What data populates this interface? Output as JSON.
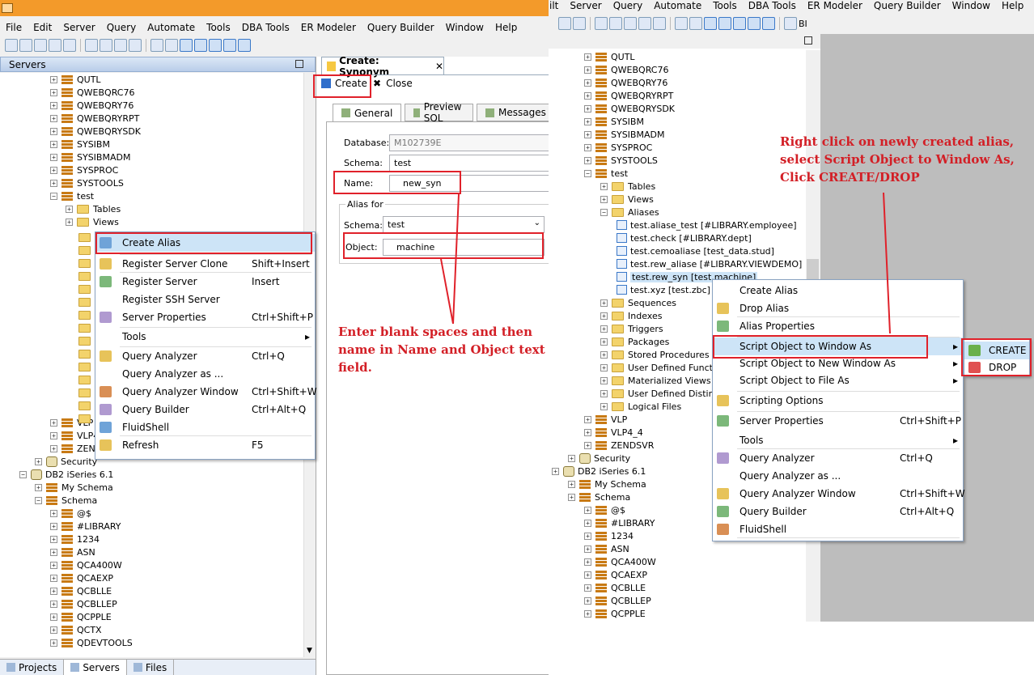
{
  "left": {
    "menu": [
      "File",
      "Edit",
      "Server",
      "Query",
      "Automate",
      "Tools",
      "DBA Tools",
      "ER Modeler",
      "Query Builder",
      "Window",
      "Help"
    ],
    "servers_title": "Servers",
    "tree": [
      {
        "label": "QUTL",
        "kind": "schema",
        "lvl": 3
      },
      {
        "label": "QWEBQRC76",
        "kind": "schema",
        "lvl": 3
      },
      {
        "label": "QWEBQRY76",
        "kind": "schema",
        "lvl": 3
      },
      {
        "label": "QWEBQRYRPT",
        "kind": "schema",
        "lvl": 3
      },
      {
        "label": "QWEBQRYSDK",
        "kind": "schema",
        "lvl": 3
      },
      {
        "label": "SYSIBM",
        "kind": "schema",
        "lvl": 3
      },
      {
        "label": "SYSIBMADM",
        "kind": "schema",
        "lvl": 3
      },
      {
        "label": "SYSPROC",
        "kind": "schema",
        "lvl": 3
      },
      {
        "label": "SYSTOOLS",
        "kind": "schema",
        "lvl": 3
      },
      {
        "label": "test",
        "kind": "schema",
        "lvl": 3,
        "open": true
      },
      {
        "label": "Tables",
        "kind": "folder",
        "lvl": 4
      },
      {
        "label": "Views",
        "kind": "folder",
        "lvl": 4
      }
    ],
    "tree_lower": [
      {
        "label": "VLP",
        "kind": "schema",
        "lvl": 3,
        "row": 28
      },
      {
        "label": "VLP4",
        "kind": "schema",
        "lvl": 3,
        "row": 29
      },
      {
        "label": "ZEND",
        "kind": "schema",
        "lvl": 3,
        "row": 30
      },
      {
        "label": "Security",
        "kind": "db",
        "lvl": 2,
        "row": 31
      },
      {
        "label": "DB2 iSeries 6.1",
        "kind": "db",
        "lvl": 1,
        "row": 32,
        "open": true
      },
      {
        "label": "My Schema",
        "kind": "schema",
        "lvl": 2,
        "row": 33
      },
      {
        "label": "Schema",
        "kind": "schema",
        "lvl": 2,
        "row": 34,
        "open": true
      },
      {
        "label": "@$",
        "kind": "schema",
        "lvl": 3,
        "row": 35
      },
      {
        "label": "#LIBRARY",
        "kind": "schema",
        "lvl": 3,
        "row": 36
      },
      {
        "label": "1234",
        "kind": "schema",
        "lvl": 3,
        "row": 37
      },
      {
        "label": "ASN",
        "kind": "schema",
        "lvl": 3,
        "row": 38
      },
      {
        "label": "QCA400W",
        "kind": "schema",
        "lvl": 3,
        "row": 39
      },
      {
        "label": "QCAEXP",
        "kind": "schema",
        "lvl": 3,
        "row": 40
      },
      {
        "label": "QCBLLE",
        "kind": "schema",
        "lvl": 3,
        "row": 41
      },
      {
        "label": "QCBLLEP",
        "kind": "schema",
        "lvl": 3,
        "row": 42
      },
      {
        "label": "QCPPLE",
        "kind": "schema",
        "lvl": 3,
        "row": 43
      },
      {
        "label": "QCTX",
        "kind": "schema",
        "lvl": 3,
        "row": 44
      },
      {
        "label": "QDEVTOOLS",
        "kind": "schema",
        "lvl": 3,
        "row": 45
      }
    ],
    "context_menu": [
      {
        "label": "Create Alias",
        "shortcut": "",
        "sel": true
      },
      {
        "label": "Register Server Clone",
        "shortcut": "Shift+Insert"
      },
      {
        "label": "Register Server",
        "shortcut": "Insert"
      },
      {
        "label": "Register SSH Server",
        "shortcut": ""
      },
      {
        "label": "Server Properties",
        "shortcut": "Ctrl+Shift+P"
      },
      {
        "label": "Tools",
        "shortcut": "",
        "sub": true
      },
      {
        "label": "Query Analyzer",
        "shortcut": "Ctrl+Q"
      },
      {
        "label": "Query Analyzer as ...",
        "shortcut": ""
      },
      {
        "label": "Query Analyzer Window",
        "shortcut": "Ctrl+Shift+W"
      },
      {
        "label": "Query Builder",
        "shortcut": "Ctrl+Alt+Q"
      },
      {
        "label": "FluidShell",
        "shortcut": ""
      },
      {
        "label": "Refresh",
        "shortcut": "F5"
      }
    ],
    "bottom_tabs": [
      "Projects",
      "Servers",
      "Files"
    ],
    "editor": {
      "tab_title": "Create: Synonym",
      "create_btn": "Create",
      "close_btn": "Close",
      "subtabs": [
        "General",
        "Preview SQL",
        "Messages"
      ],
      "database_label": "Database:",
      "database_value": "M102739E",
      "schema_label": "Schema:",
      "schema_value": "test",
      "name_label": "Name:",
      "name_value": "new_syn",
      "alias_for": "Alias for",
      "aschema_label": "Schema:",
      "aschema_value": "test",
      "object_label": "Object:",
      "object_value": "machine"
    },
    "note": "Enter blank spaces and then name in Name and Object text field."
  },
  "right": {
    "menu": [
      "ilt",
      "Server",
      "Query",
      "Automate",
      "Tools",
      "DBA Tools",
      "ER Modeler",
      "Query Builder",
      "Window",
      "Help"
    ],
    "tree": [
      {
        "label": "QUTL",
        "kind": "schema",
        "lvl": 1
      },
      {
        "label": "QWEBQRC76",
        "kind": "schema",
        "lvl": 1
      },
      {
        "label": "QWEBQRY76",
        "kind": "schema",
        "lvl": 1
      },
      {
        "label": "QWEBQRYRPT",
        "kind": "schema",
        "lvl": 1
      },
      {
        "label": "QWEBQRYSDK",
        "kind": "schema",
        "lvl": 1
      },
      {
        "label": "SYSIBM",
        "kind": "schema",
        "lvl": 1
      },
      {
        "label": "SYSIBMADM",
        "kind": "schema",
        "lvl": 1
      },
      {
        "label": "SYSPROC",
        "kind": "schema",
        "lvl": 1
      },
      {
        "label": "SYSTOOLS",
        "kind": "schema",
        "lvl": 1
      },
      {
        "label": "test",
        "kind": "schema",
        "lvl": 1,
        "open": true
      },
      {
        "label": "Tables",
        "kind": "folder",
        "lvl": 2
      },
      {
        "label": "Views",
        "kind": "folder",
        "lvl": 2
      },
      {
        "label": "Aliases",
        "kind": "folder",
        "lvl": 2,
        "open": true
      },
      {
        "label": "test.aliase_test [#LIBRARY.employee]",
        "kind": "alias",
        "lvl": 3
      },
      {
        "label": "test.check [#LIBRARY.dept]",
        "kind": "alias",
        "lvl": 3
      },
      {
        "label": "test.cemoaliase [test_data.stud]",
        "kind": "alias",
        "lvl": 3
      },
      {
        "label": "test.rew_aliase [#LIBRARY.VIEWDEMO]",
        "kind": "alias",
        "lvl": 3
      },
      {
        "label": "test.rew_syn [test.machine]",
        "kind": "alias",
        "lvl": 3,
        "sel": true
      },
      {
        "label": "test.xyz [test.zbc]",
        "kind": "alias",
        "lvl": 3
      },
      {
        "label": "Sequences",
        "kind": "folder",
        "lvl": 2
      },
      {
        "label": "Indexes",
        "kind": "folder",
        "lvl": 2
      },
      {
        "label": "Triggers",
        "kind": "folder",
        "lvl": 2
      },
      {
        "label": "Packages",
        "kind": "folder",
        "lvl": 2
      },
      {
        "label": "Stored Procedures",
        "kind": "folder",
        "lvl": 2
      },
      {
        "label": "User Defined Functions",
        "kind": "folder",
        "lvl": 2
      },
      {
        "label": "Materialized Views",
        "kind": "folder",
        "lvl": 2
      },
      {
        "label": "User Defined Distinct Datatyp",
        "kind": "folder",
        "lvl": 2
      },
      {
        "label": "Logical Files",
        "kind": "folder",
        "lvl": 2
      },
      {
        "label": "VLP",
        "kind": "schema",
        "lvl": 1
      },
      {
        "label": "VLP4_4",
        "kind": "schema",
        "lvl": 1
      },
      {
        "label": "ZENDSVR",
        "kind": "schema",
        "lvl": 1
      },
      {
        "label": "Security",
        "kind": "db",
        "lvl": 0
      },
      {
        "label": "DB2 iSeries 6.1",
        "kind": "db",
        "lvl": -1
      },
      {
        "label": "My Schema",
        "kind": "schema",
        "lvl": 0
      },
      {
        "label": "Schema",
        "kind": "schema",
        "lvl": 0
      },
      {
        "label": "@$",
        "kind": "schema",
        "lvl": 1
      },
      {
        "label": "#LIBRARY",
        "kind": "schema",
        "lvl": 1
      },
      {
        "label": "1234",
        "kind": "schema",
        "lvl": 1
      },
      {
        "label": "ASN",
        "kind": "schema",
        "lvl": 1
      },
      {
        "label": "QCA400W",
        "kind": "schema",
        "lvl": 1
      },
      {
        "label": "QCAEXP",
        "kind": "schema",
        "lvl": 1
      },
      {
        "label": "QCBLLE",
        "kind": "schema",
        "lvl": 1
      },
      {
        "label": "QCBLLEP",
        "kind": "schema",
        "lvl": 1
      },
      {
        "label": "QCPPLE",
        "kind": "schema",
        "lvl": 1
      }
    ],
    "context_menu": [
      {
        "label": "Create Alias",
        "shortcut": ""
      },
      {
        "label": "Drop Alias",
        "shortcut": ""
      },
      {
        "label": "Alias Properties",
        "shortcut": ""
      },
      {
        "label": "Script Object to Window As",
        "shortcut": "",
        "sub": true,
        "sel": true
      },
      {
        "label": "Script Object to New Window As",
        "shortcut": "",
        "sub": true
      },
      {
        "label": "Script Object to File As",
        "shortcut": "",
        "sub": true
      },
      {
        "label": "Scripting Options",
        "shortcut": ""
      },
      {
        "label": "Server Properties",
        "shortcut": "Ctrl+Shift+P"
      },
      {
        "label": "Tools",
        "shortcut": "",
        "sub": true
      },
      {
        "label": "Query Analyzer",
        "shortcut": "Ctrl+Q"
      },
      {
        "label": "Query Analyzer as ...",
        "shortcut": ""
      },
      {
        "label": "Query Analyzer Window",
        "shortcut": "Ctrl+Shift+W"
      },
      {
        "label": "Query Builder",
        "shortcut": "Ctrl+Alt+Q"
      },
      {
        "label": "FluidShell",
        "shortcut": ""
      }
    ],
    "submenu": [
      "CREATE",
      "DROP"
    ],
    "note": "Right click on newly created alias, select Script Object to Window As, Click CREATE/DROP"
  },
  "colors": {
    "accent": "#e0212a",
    "selection": "#cde4f7",
    "gray_panel": "#bdbdbd"
  }
}
